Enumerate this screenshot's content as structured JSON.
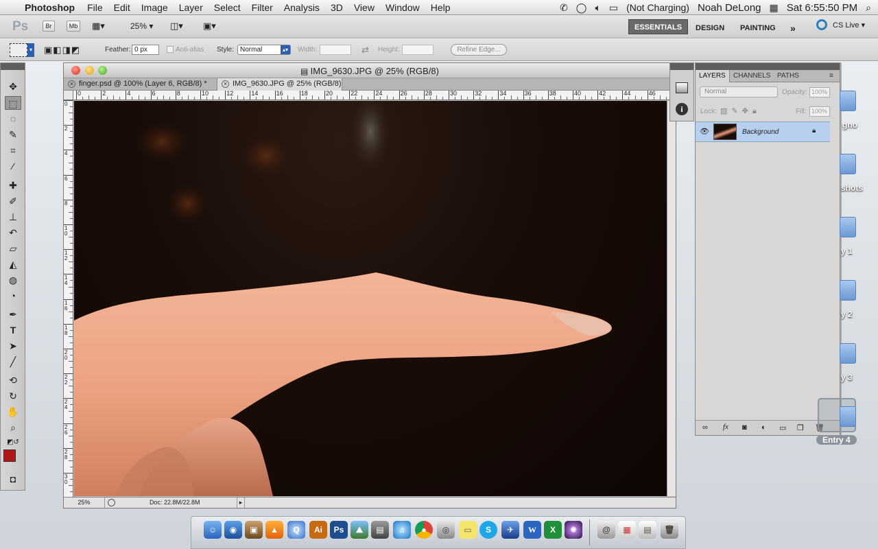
{
  "menubar": {
    "app_name": "Photoshop",
    "menus": [
      "File",
      "Edit",
      "Image",
      "Layer",
      "Select",
      "Filter",
      "Analysis",
      "3D",
      "View",
      "Window",
      "Help"
    ],
    "battery": "(Not Charging)",
    "user": "Noah DeLong",
    "clock": "Sat 6:55:50 PM"
  },
  "appbar": {
    "logo": "Ps",
    "bridge": "Br",
    "minibridge": "Mb",
    "zoom": "25%",
    "workspaces": [
      "ESSENTIALS",
      "DESIGN",
      "PAINTING"
    ],
    "more": "»",
    "cs_live": "CS Live"
  },
  "options": {
    "feather_label": "Feather:",
    "feather_value": "0 px",
    "antialias_label": "Anti-alias",
    "style_label": "Style:",
    "style_value": "Normal",
    "width_label": "Width:",
    "height_label": "Height:",
    "refine_edge": "Refine Edge..."
  },
  "document": {
    "title": "IMG_9630.JPG @ 25% (RGB/8)",
    "tabs": [
      {
        "label": "finger.psd @ 100% (Layer 6, RGB/8) *"
      },
      {
        "label": "IMG_9630.JPG @ 25% (RGB/8)"
      }
    ],
    "ruler_h": [
      "0",
      "2",
      "4",
      "6",
      "8",
      "10",
      "12",
      "14",
      "16",
      "18",
      "20",
      "22",
      "24",
      "26",
      "28",
      "30",
      "32",
      "34",
      "36",
      "38",
      "40",
      "42",
      "44",
      "46"
    ],
    "ruler_v": [
      "0",
      "2",
      "4",
      "6",
      "8",
      "10",
      "12",
      "14",
      "16",
      "18",
      "20",
      "22",
      "24",
      "26",
      "28",
      "30"
    ],
    "zoom_status": "25%",
    "doc_size": "Doc: 22.8M/22.8M"
  },
  "layers_panel": {
    "tabs": [
      "LAYERS",
      "CHANNELS",
      "PATHS"
    ],
    "blend_mode": "Normal",
    "opacity_label": "Opacity:",
    "opacity_value": "100%",
    "lock_label": "Lock:",
    "fill_label": "Fill:",
    "fill_value": "100%",
    "layer_name": "Background"
  },
  "desktop": {
    "labels": [
      "gno",
      "shots",
      "y 1",
      "y 2",
      "y 3",
      "Entry 4"
    ]
  },
  "colors": {
    "foreground": "#b01818",
    "background": "#ffffff",
    "selection_blue": "#b7d0ef"
  }
}
